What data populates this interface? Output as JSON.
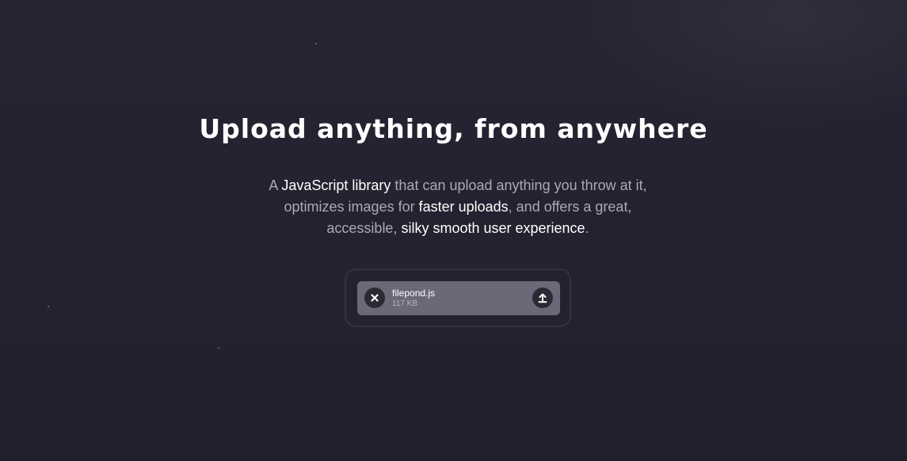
{
  "hero": {
    "title": "Upload anything, from anywhere",
    "lead": {
      "p1": "A ",
      "hl1": "JavaScript library",
      "p2": " that can upload anything you throw at it, optimizes images for ",
      "hl2": "faster uploads",
      "p3": ", and offers a great, accessible, ",
      "hl3": "silky smooth user experience",
      "p4": "."
    }
  },
  "uploader": {
    "file": {
      "name": "filepond.js",
      "size": "117 KB"
    },
    "icons": {
      "remove": "close-icon",
      "upload": "upload-arrow-icon"
    }
  },
  "colors": {
    "background": "#22222f",
    "text_highlight": "#ffffff",
    "text_muted": "#a9a9b8",
    "file_item": "#6b6878",
    "button": "#2a2a35"
  }
}
